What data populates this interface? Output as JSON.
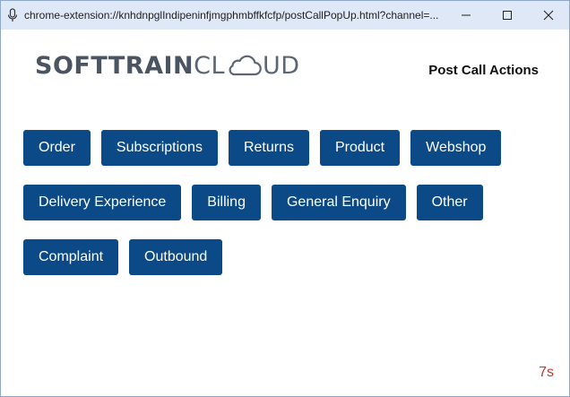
{
  "window": {
    "url": "chrome-extension://knhdnpglIndipeninfjmgphmbffkfcfp/postCallPopUp.html?channel=...",
    "controls": [
      "minimize-icon",
      "maximize-icon",
      "close-icon"
    ]
  },
  "header": {
    "logo_bold": "SOFTTRAIN",
    "logo_cl": "CL",
    "logo_ud": "UD",
    "title": "Post Call Actions"
  },
  "actions": {
    "row1": [
      "Order",
      "Subscriptions",
      "Returns",
      "Product",
      "Webshop"
    ],
    "row2": [
      "Delivery Experience",
      "Billing",
      "General Enquiry",
      "Other"
    ],
    "row3": [
      "Complaint",
      "Outbound"
    ]
  },
  "timer": "7s",
  "colors": {
    "button_bg": "#0b4a86",
    "titlebar_bg": "#dfe8f7",
    "timer": "#c0392b",
    "logo": "#4a5463"
  }
}
